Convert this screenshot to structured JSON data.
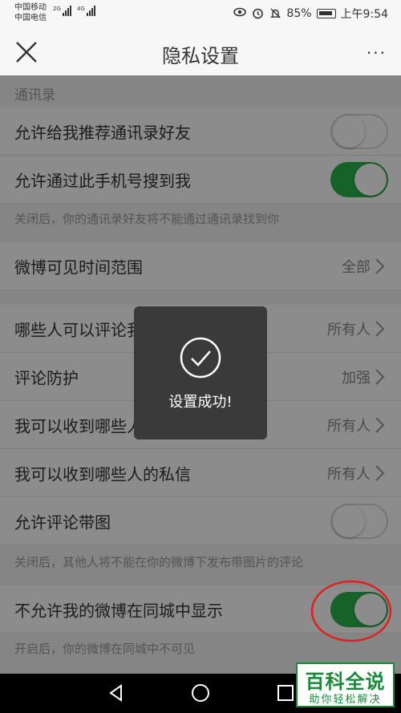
{
  "status_bar": {
    "carrier_1": "中国移动",
    "carrier_2": "中国电信",
    "signal_1_label": "2G",
    "signal_2_label": "4G",
    "battery": "85%",
    "time": "上午9:54"
  },
  "nav": {
    "title": "隐私设置",
    "more": "···"
  },
  "sections": {
    "contacts_header": "通讯录",
    "recommend_contacts": {
      "label": "允许给我推荐通讯录好友",
      "toggle": "off"
    },
    "search_by_phone": {
      "label": "允许通过此手机号搜到我",
      "toggle": "on"
    },
    "search_by_phone_note": "关闭后，你的通讯录好友将不能通过通讯录找到你",
    "visible_range": {
      "label": "微博可见时间范围",
      "value": "全部"
    },
    "who_can_comment": {
      "label": "哪些人可以评论我",
      "value": "所有人"
    },
    "comment_protection": {
      "label": "评论防护",
      "value": "加强"
    },
    "receive_comments_from": {
      "label": "我可以收到哪些人的评论",
      "value": "所有人"
    },
    "receive_messages_from": {
      "label": "我可以收到哪些人的私信",
      "value": "所有人"
    },
    "allow_comment_images": {
      "label": "允许评论带图",
      "toggle": "off"
    },
    "comment_images_note": "关闭后，其他人将不能在你的微博下发布带图片的评论",
    "hide_in_local": {
      "label": "不允许我的微博在同城中显示",
      "toggle": "on"
    },
    "hide_in_local_note": "开启后，你的微博在同城中不可见"
  },
  "toast": {
    "message": "设置成功!"
  },
  "watermark": {
    "main": "百科全说",
    "sub": "助你轻松解决"
  },
  "colors": {
    "toggle_on": "#2bb24c",
    "annotation": "#e02020",
    "watermark": "#1a8a3a"
  }
}
